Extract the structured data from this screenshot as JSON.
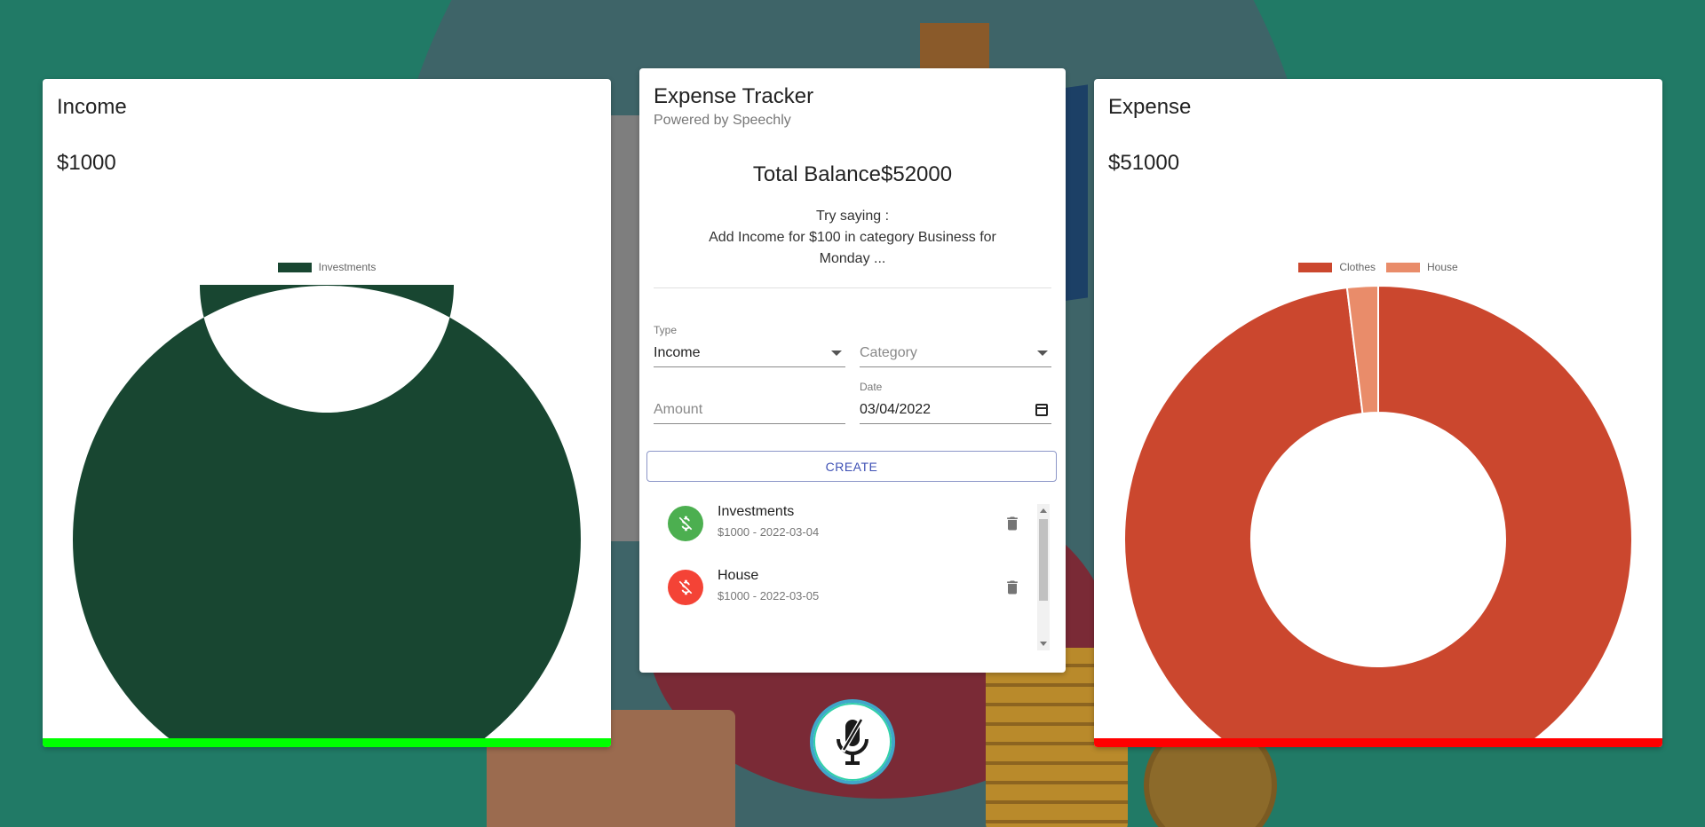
{
  "income": {
    "title": "Income",
    "total": "$1000",
    "bar_color": "#00FF00",
    "chart_data": {
      "type": "pie",
      "style": "doughnut",
      "categories": [
        "Investments"
      ],
      "values": [
        1000
      ],
      "colors": [
        "#184631"
      ],
      "legend": "top"
    }
  },
  "tracker": {
    "title": "Expense Tracker",
    "subtitle": "Powered by Speechly",
    "balance": "Total Balance$52000",
    "hint_line1": "Try saying :",
    "hint_line2": "Add Income for $100 in category Business for Monday ...",
    "form": {
      "type_label": "Type",
      "type_value": "Income",
      "category_placeholder": "Category",
      "amount_placeholder": "Amount",
      "date_label": "Date",
      "date_value": "03/04/2022"
    },
    "create_label": "CREATE",
    "transactions": [
      {
        "name": "Investments",
        "detail": "$1000 - 2022-03-04",
        "kind": "income",
        "color": "#4CAF50",
        "icon": "money-off-icon"
      },
      {
        "name": "House",
        "detail": "$1000 - 2022-03-05",
        "kind": "expense",
        "color": "#F44336",
        "icon": "money-off-icon"
      }
    ]
  },
  "expense": {
    "title": "Expense",
    "total": "$51000",
    "bar_color": "#FF0000",
    "chart_data": {
      "type": "pie",
      "style": "doughnut",
      "categories": [
        "Clothes",
        "House"
      ],
      "values": [
        50000,
        1000
      ],
      "colors": [
        "#CB472E",
        "#E98C6A"
      ],
      "legend": "top"
    }
  },
  "mic": {
    "icon": "microphone-off-icon"
  }
}
